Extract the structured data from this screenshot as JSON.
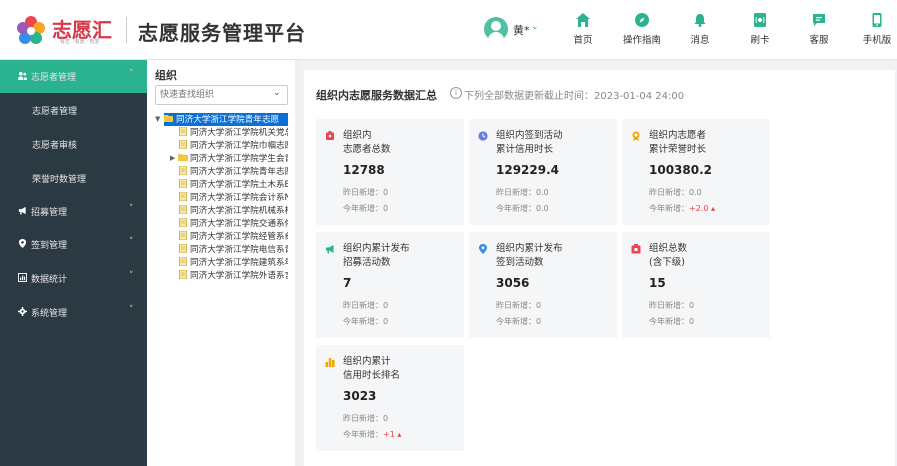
{
  "header": {
    "logo_text": "志愿汇",
    "logo_sub": "有志 · 有愿 · 有爱",
    "app_title": "志愿服务管理平台",
    "user_name": "黄*",
    "nav": [
      {
        "label": "首页",
        "icon": "home-icon"
      },
      {
        "label": "操作指南",
        "icon": "compass-icon"
      },
      {
        "label": "消息",
        "icon": "bell-icon"
      },
      {
        "label": "刷卡",
        "icon": "card-reader-icon"
      },
      {
        "label": "客服",
        "icon": "chat-icon"
      },
      {
        "label": "手机版",
        "icon": "mobile-icon"
      }
    ],
    "colors": {
      "brand": "#2bb28f",
      "logo_red": "#d6384b"
    }
  },
  "sidebar": {
    "items": [
      {
        "label": "志愿者管理",
        "icon": "users-icon",
        "expanded": true,
        "active": true,
        "children": [
          "志愿者管理",
          "志愿者审核",
          "荣誉时数管理"
        ]
      },
      {
        "label": "招募管理",
        "icon": "megaphone-icon",
        "expanded": false
      },
      {
        "label": "签到管理",
        "icon": "location-icon",
        "expanded": false
      },
      {
        "label": "数据统计",
        "icon": "chart-icon",
        "expanded": false
      },
      {
        "label": "系统管理",
        "icon": "gear-icon",
        "expanded": false
      }
    ]
  },
  "org": {
    "title": "组织",
    "search_placeholder": "快速查找组织",
    "root": "同济大学浙江学院青年志愿",
    "children": [
      "同济大学浙江学院机关党总",
      "同济大学浙江学院巾帼志愿",
      "同济大学浙江学院学生会青",
      "同济大学浙江学院青年志愿",
      "同济大学浙江学院土木系E",
      "同济大学浙江学院会计系N",
      "同济大学浙江学院机械系析",
      "同济大学浙江学院交通系侬",
      "同济大学浙江学院经管系纟",
      "同济大学浙江学院电信系青",
      "同济大学浙江学院建筑系年",
      "同济大学浙江学院外语系言"
    ]
  },
  "summary": {
    "title": "组织内志愿服务数据汇总",
    "update_note": "下列全部数据更新截止时间：2023-01-04 24:00",
    "yesterday_label": "昨日新增：",
    "year_label": "今年新增：",
    "cards": [
      {
        "label1": "组织内",
        "label2": "志愿者总数",
        "value": "12788",
        "yesterday": "0",
        "year": "0",
        "year_up": false,
        "icon": "user-badge-icon",
        "color": "#e8474f"
      },
      {
        "label1": "组织内签到活动",
        "label2": "累计信用时长",
        "value": "129229.4",
        "yesterday": "0.0",
        "year": "0.0",
        "year_up": false,
        "icon": "clock-icon",
        "color": "#6a7de0"
      },
      {
        "label1": "组织内志愿者",
        "label2": "累计荣誉时长",
        "value": "100380.2",
        "yesterday": "0.0",
        "year": "+2.0",
        "year_up": true,
        "icon": "medal-icon",
        "color": "#f0a500"
      },
      {
        "label1": "组织内累计发布",
        "label2": "招募活动数",
        "value": "7",
        "yesterday": "0",
        "year": "0",
        "year_up": false,
        "icon": "megaphone-icon",
        "color": "#2bb28f"
      },
      {
        "label1": "组织内累计发布",
        "label2": "签到活动数",
        "value": "3056",
        "yesterday": "0",
        "year": "0",
        "year_up": false,
        "icon": "pin-icon",
        "color": "#3a8ee6"
      },
      {
        "label1": "组织总数",
        "label2": "(含下级)",
        "value": "15",
        "yesterday": "0",
        "year": "0",
        "year_up": false,
        "icon": "org-icon",
        "color": "#e8474f"
      },
      {
        "label1": "组织内累计",
        "label2": "信用时长排名",
        "value": "3023",
        "yesterday": "0",
        "year": "+1",
        "year_up": true,
        "icon": "bar-chart-icon",
        "color": "#f0a500"
      }
    ]
  }
}
